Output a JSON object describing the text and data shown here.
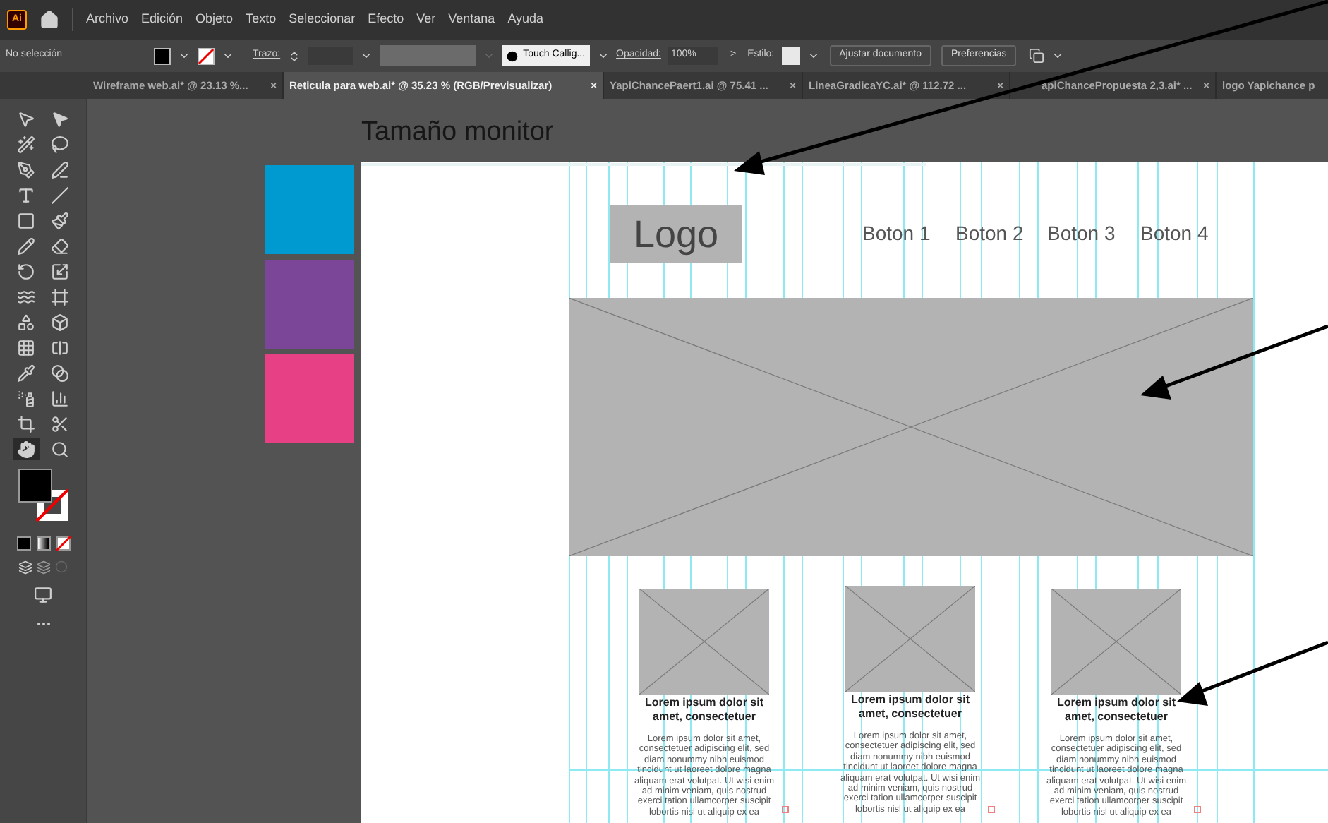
{
  "app": {
    "logo": "Ai",
    "menu": [
      "Archivo",
      "Edición",
      "Objeto",
      "Texto",
      "Seleccionar",
      "Efecto",
      "Ver",
      "Ventana",
      "Ayuda"
    ]
  },
  "control_bar": {
    "selection": "No selección",
    "stroke_label": "Trazo:",
    "brush": "Touch Callig...",
    "opacity_label": "Opacidad:",
    "opacity": "100%",
    "more": ">",
    "style_label": "Estilo:",
    "buttons": [
      "Ajustar documento",
      "Preferencias"
    ]
  },
  "tabs": [
    {
      "label": "Wireframe web.ai* @ 23.13 %...",
      "close": "×",
      "selected": false
    },
    {
      "label": "Reticula para web.ai* @ 35.23 % (RGB/Previsualizar)",
      "close": "×",
      "selected": true
    },
    {
      "label": "YapiChancePaert1.ai @ 75.41 ...",
      "close": "×",
      "selected": false
    },
    {
      "label": "LineaGradicaYC.ai* @ 112.72 ...",
      "close": "×",
      "selected": false
    },
    {
      "label": "apiChancePropuesta 2,3.ai* ...",
      "close": "×",
      "selected": false
    },
    {
      "label": "logo Yapichance p",
      "selected": false
    }
  ],
  "toolbar": {
    "tools": [
      {
        "selected": false
      },
      {
        "selected": false
      },
      {
        "selected": false
      },
      {
        "selected": false
      },
      {
        "selected": false
      },
      {
        "selected": false
      },
      {
        "selected": false
      },
      {
        "selected": false
      },
      {
        "selected": false
      },
      {
        "selected": false
      },
      {
        "selected": false
      },
      {
        "selected": false
      },
      {
        "selected": false
      },
      {
        "selected": false
      },
      {
        "selected": false
      },
      {
        "selected": false
      },
      {
        "selected": false
      },
      {
        "selected": false
      },
      {
        "selected": false
      },
      {
        "selected": false
      },
      {
        "selected": false
      },
      {
        "selected": false
      },
      {
        "selected": false
      },
      {
        "selected": false
      },
      {
        "selected": false
      },
      {
        "selected": false
      },
      {
        "selected": true
      },
      {
        "selected": false
      }
    ]
  },
  "canvas": {
    "title": "Tamaño monitor",
    "swatches": [
      {
        "color": "#0099d0"
      },
      {
        "color": "#7b4598"
      },
      {
        "color": "#e84085"
      }
    ],
    "artboard": {
      "logo": "Logo",
      "nav": [
        "Boton 1",
        "Boton 2",
        "Boton 3",
        "Boton 4"
      ],
      "cards": [
        {
          "title": [
            "Lorem ipsum dolor sit",
            "amet, consectetuer"
          ],
          "body": [
            "Lorem ipsum dolor sit amet,",
            "consectetuer adipiscing elit, sed",
            "diam nonummy nibh euismod",
            "tincidunt ut laoreet dolore magna",
            "aliquam erat volutpat. Ut wisi enim",
            "ad minim veniam, quis nostrud",
            "exerci tation ullamcorper suscipit",
            "lobortis nisl ut aliquip ex ea"
          ]
        },
        {
          "title": [
            "Lorem ipsum dolor sit",
            "amet, consectetuer"
          ],
          "body": [
            "Lorem ipsum dolor sit amet,",
            "consectetuer adipiscing elit, sed",
            "diam nonummy nibh euismod",
            "tincidunt ut laoreet dolore magna",
            "aliquam erat volutpat. Ut wisi enim",
            "ad minim veniam, quis nostrud",
            "exerci tation ullamcorper suscipit",
            "lobortis nisl ut aliquip ex ea"
          ]
        },
        {
          "title": [
            "Lorem ipsum dolor sit",
            "amet, consectetuer"
          ],
          "body": [
            "Lorem ipsum dolor sit amet,",
            "consectetuer adipiscing elit, sed",
            "diam nonummy nibh euismod",
            "tincidunt ut laoreet dolore magna",
            "aliquam erat volutpat. Ut wisi enim",
            "ad minim veniam, quis nostrud",
            "exerci tation ullamcorper suscipit",
            "lobortis nisl ut aliquip ex ea"
          ]
        }
      ]
    }
  }
}
